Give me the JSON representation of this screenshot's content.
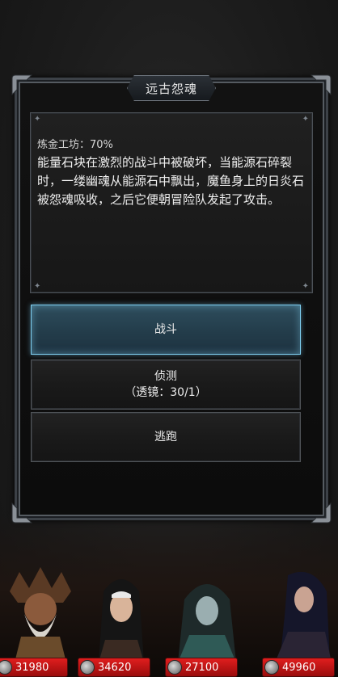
{
  "dialog": {
    "title": "远古怨魂",
    "workshop": "炼金工坊：70%",
    "description": "能量石块在激烈的战斗中被破坏，当能源石碎裂时，一缕幽魂从能源石中飘出，魔鱼身上的日炎石被怨魂吸收，之后它便朝冒险队发起了攻击。"
  },
  "options": {
    "fight": "战斗",
    "detect_line1": "侦测",
    "detect_line2": "（透镜：30/1）",
    "flee": "逃跑"
  },
  "party": [
    {
      "hp": "31980",
      "portrait": "bearded-druid"
    },
    {
      "hp": "34620",
      "portrait": "nun"
    },
    {
      "hp": "27100",
      "portrait": "hooded-mage"
    },
    {
      "hp": "49960",
      "portrait": "dark-haired-warrior"
    }
  ],
  "colors": {
    "selected_option": "#2e4d5d",
    "hp_bar": "#e01e1e"
  }
}
